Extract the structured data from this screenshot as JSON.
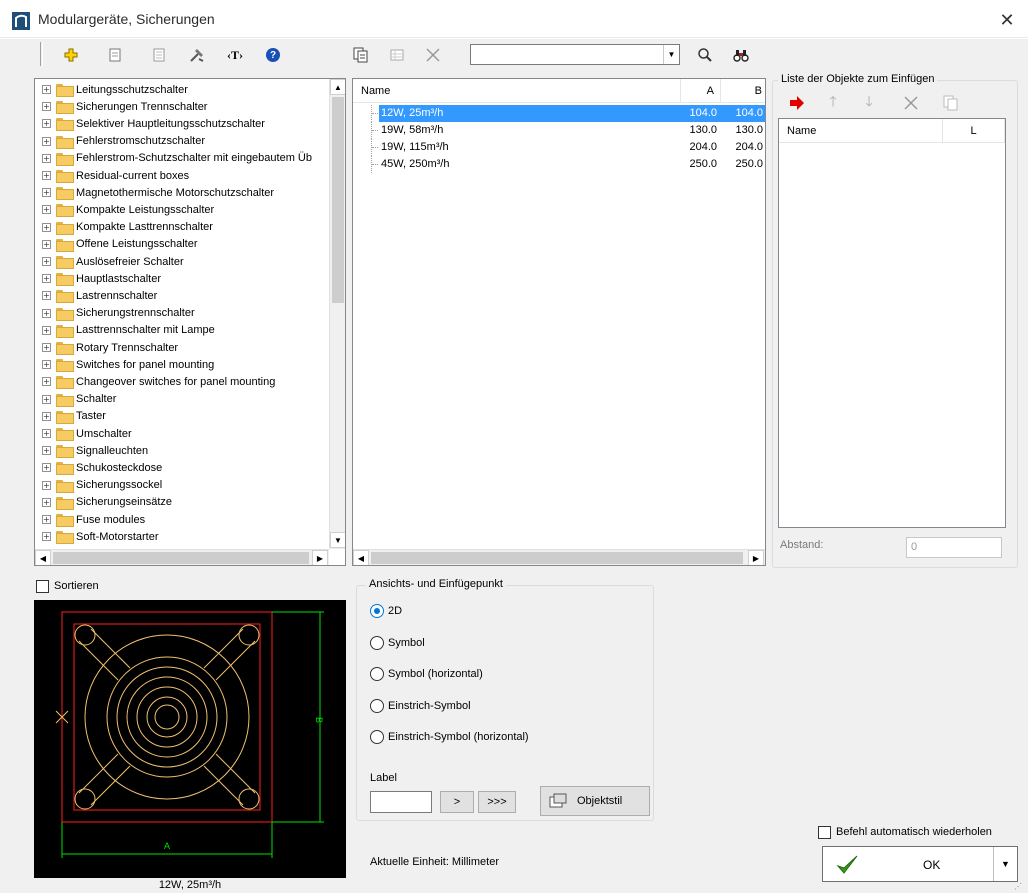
{
  "window": {
    "title": "Modulargeräte, Sicherungen"
  },
  "toolbar": {
    "search_value": "",
    "icons": [
      "add-icon",
      "properties-icon",
      "document-icon",
      "tools-icon",
      "text-icon",
      "help-icon",
      "copy-icon",
      "grid-icon",
      "delete-icon",
      "search-icon",
      "binoculars-icon"
    ],
    "text_icon_glyph": "‹T›",
    "help_glyph": "?"
  },
  "tree": {
    "items": [
      "Leitungsschutzschalter",
      "Sicherungen Trennschalter",
      "Selektiver Hauptleitungsschutzschalter",
      "Fehlerstromschutzschalter",
      "Fehlerstrom-Schutzschalter mit eingebautem Üb",
      "Residual-current boxes",
      "Magnetothermische Motorschutzschalter",
      "Kompakte Leistungsschalter",
      "Kompakte Lasttrennschalter",
      "Offene Leistungsschalter",
      "Auslösefreier Schalter",
      "Hauptlastschalter",
      "Lastrennschalter",
      "Sicherungstrennschalter",
      "Lasttrennschalter mit Lampe",
      "Rotary Trennschalter",
      "Switches for panel mounting",
      "Changeover switches for panel mounting",
      "Schalter",
      "Taster",
      "Umschalter",
      "Signalleuchten",
      "Schukosteckdose",
      "Sicherungssockel",
      "Sicherungseinsätze",
      "Fuse modules",
      "Soft-Motorstarter"
    ],
    "expander_glyph": "+"
  },
  "list": {
    "columns": [
      "Name",
      "A",
      "B"
    ],
    "rows": [
      {
        "name": "12W, 25m³/h",
        "a": "104.0",
        "b": "104.0",
        "selected": true
      },
      {
        "name": "19W, 58m³/h",
        "a": "130.0",
        "b": "130.0",
        "selected": false
      },
      {
        "name": "19W, 115m³/h",
        "a": "204.0",
        "b": "204.0",
        "selected": false
      },
      {
        "name": "45W, 250m³/h",
        "a": "250.0",
        "b": "250.0",
        "selected": false
      }
    ]
  },
  "insert_list": {
    "title": "Liste der Objekte zum Einfügen",
    "columns": [
      "Name",
      "L"
    ],
    "spacing_label": "Abstand:",
    "spacing_value": "0"
  },
  "sort": {
    "label": "Sortieren",
    "checked": false
  },
  "preview": {
    "caption": "12W, 25m³/h",
    "dim_a": "A",
    "dim_b": "B"
  },
  "view_group": {
    "title": "Ansichts- und Einfügepunkt",
    "options": [
      {
        "label": "2D",
        "checked": true
      },
      {
        "label": "Symbol",
        "checked": false
      },
      {
        "label": "Symbol (horizontal)",
        "checked": false
      },
      {
        "label": "Einstrich-Symbol",
        "checked": false
      },
      {
        "label": "Einstrich-Symbol (horizontal)",
        "checked": false
      }
    ],
    "label_caption": "Label",
    "label_value": "",
    "next_button": ">",
    "next_all_button": ">>>",
    "style_button": "Objektstil"
  },
  "unit_text": "Aktuelle Einheit: Millimeter",
  "repeat": {
    "label": "Befehl automatisch wiederholen",
    "checked": false
  },
  "ok_button": "OK",
  "colors": {
    "selection": "#3399ff",
    "preview_bg": "#000000",
    "preview_line": "#f0c070",
    "preview_frame": "#ff2020",
    "dimension": "#00e000"
  }
}
